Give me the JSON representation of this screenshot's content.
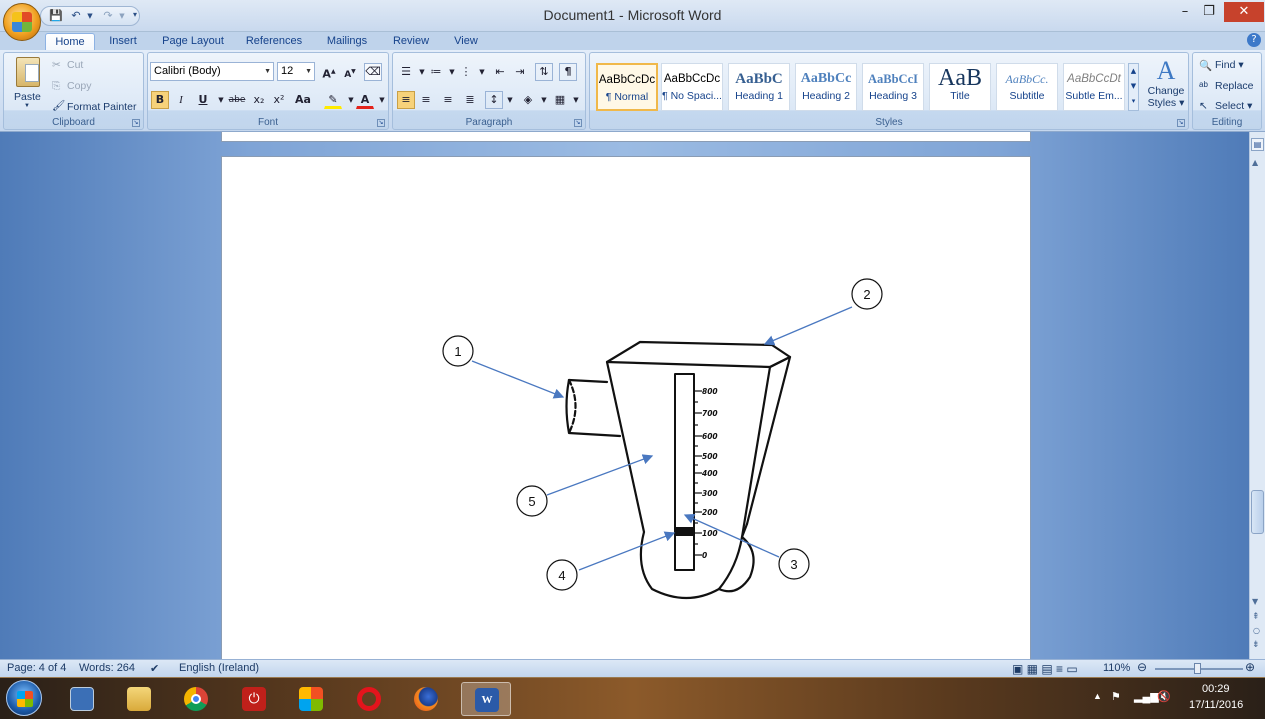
{
  "title_bar": {
    "title": "Document1 - Microsoft Word",
    "minimize_icon": "minimize-icon",
    "restore_icon": "restore-icon",
    "close_icon": "close-icon"
  },
  "quick_access": {
    "save_icon": "save-icon",
    "undo_icon": "undo-icon",
    "redo_icon": "redo-icon",
    "customize_icon": "chevron-down-icon"
  },
  "tabs": [
    {
      "label": "Home",
      "active": true
    },
    {
      "label": "Insert"
    },
    {
      "label": "Page Layout"
    },
    {
      "label": "References"
    },
    {
      "label": "Mailings"
    },
    {
      "label": "Review"
    },
    {
      "label": "View"
    }
  ],
  "clipboard": {
    "paste": "Paste",
    "cut": "Cut",
    "copy": "Copy",
    "format_painter": "Format Painter",
    "group_label": "Clipboard"
  },
  "font": {
    "family": "Calibri (Body)",
    "size": "12",
    "group_label": "Font",
    "bold": "B",
    "italic": "I",
    "underline": "U",
    "strikethrough": "abe",
    "subscript": "x₂",
    "superscript": "x²",
    "change_case": "Aa",
    "grow": "A",
    "shrink": "A"
  },
  "paragraph": {
    "group_label": "Paragraph"
  },
  "styles": {
    "group_label": "Styles",
    "items": [
      {
        "sample": "AaBbCcDc",
        "name": "¶ Normal",
        "selected": true
      },
      {
        "sample": "AaBbCcDc",
        "name": "¶ No Spaci..."
      },
      {
        "sample": "AaBbC",
        "name": "Heading 1"
      },
      {
        "sample": "AaBbCc",
        "name": "Heading 2"
      },
      {
        "sample": "AaBbCcI",
        "name": "Heading 3"
      },
      {
        "sample": "AaB",
        "name": "Title"
      },
      {
        "sample": "AaBbCc.",
        "name": "Subtitle"
      },
      {
        "sample": "AaBbCcDt",
        "name": "Subtle Em..."
      }
    ],
    "change_styles": "Change",
    "change_styles_2": "Styles"
  },
  "editing": {
    "group_label": "Editing",
    "find": "Find",
    "replace": "Replace",
    "select": "Select"
  },
  "figure": {
    "callouts": [
      "1",
      "2",
      "3",
      "4",
      "5"
    ],
    "scale": [
      "800",
      "700",
      "600",
      "500",
      "400",
      "300",
      "200",
      "100",
      "0"
    ]
  },
  "status_bar": {
    "page": "Page: 4 of 4",
    "words": "Words: 264",
    "language": "English (Ireland)",
    "zoom": "110%"
  },
  "taskbar": {
    "time": "00:29",
    "date": "17/11/2016",
    "apps": [
      "start-orb",
      "control-panel",
      "file-explorer",
      "chrome",
      "shutdown-tool",
      "app-grid",
      "opera",
      "firefox",
      "word"
    ]
  }
}
